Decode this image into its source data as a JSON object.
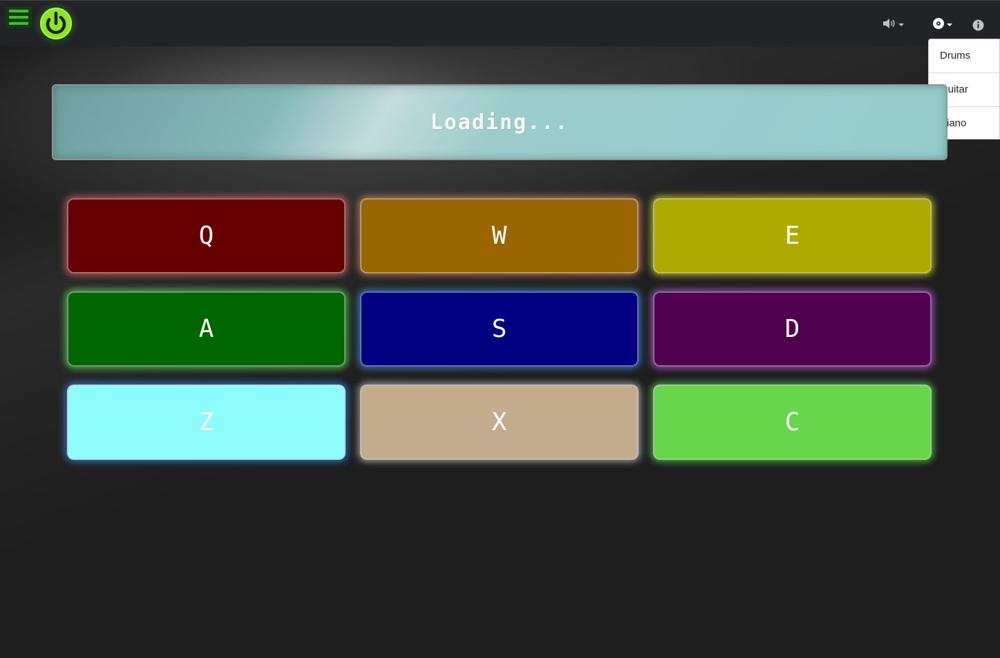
{
  "navbar": {
    "menu_icon": "hamburger-icon",
    "power_icon": "power-icon",
    "volume_icon": "volume-icon",
    "instrument_icon": "disc-icon",
    "info_icon": "info-icon",
    "accent_color": "#7fff2a"
  },
  "instrument_menu": {
    "items": [
      {
        "label": "Drums"
      },
      {
        "label": "Guitar"
      },
      {
        "label": "Piano"
      }
    ]
  },
  "display": {
    "text": "Loading..."
  },
  "pads": [
    {
      "key": "Q",
      "color": "#660000",
      "glow": "#ff6a6a"
    },
    {
      "key": "W",
      "color": "#996600",
      "glow": "#ff9966"
    },
    {
      "key": "E",
      "color": "#aeaa00",
      "glow": "#ffff33"
    },
    {
      "key": "A",
      "color": "#006600",
      "glow": "#66ff66"
    },
    {
      "key": "S",
      "color": "#000080",
      "glow": "#3aa0ff"
    },
    {
      "key": "D",
      "color": "#520050",
      "glow": "#cc66ff"
    },
    {
      "key": "Z",
      "color": "#8ffcfc",
      "glow": "#3aa0ff"
    },
    {
      "key": "X",
      "color": "#c3ab8d",
      "glow": "#dddddd"
    },
    {
      "key": "C",
      "color": "#68d64a",
      "glow": "#66ff66"
    }
  ]
}
